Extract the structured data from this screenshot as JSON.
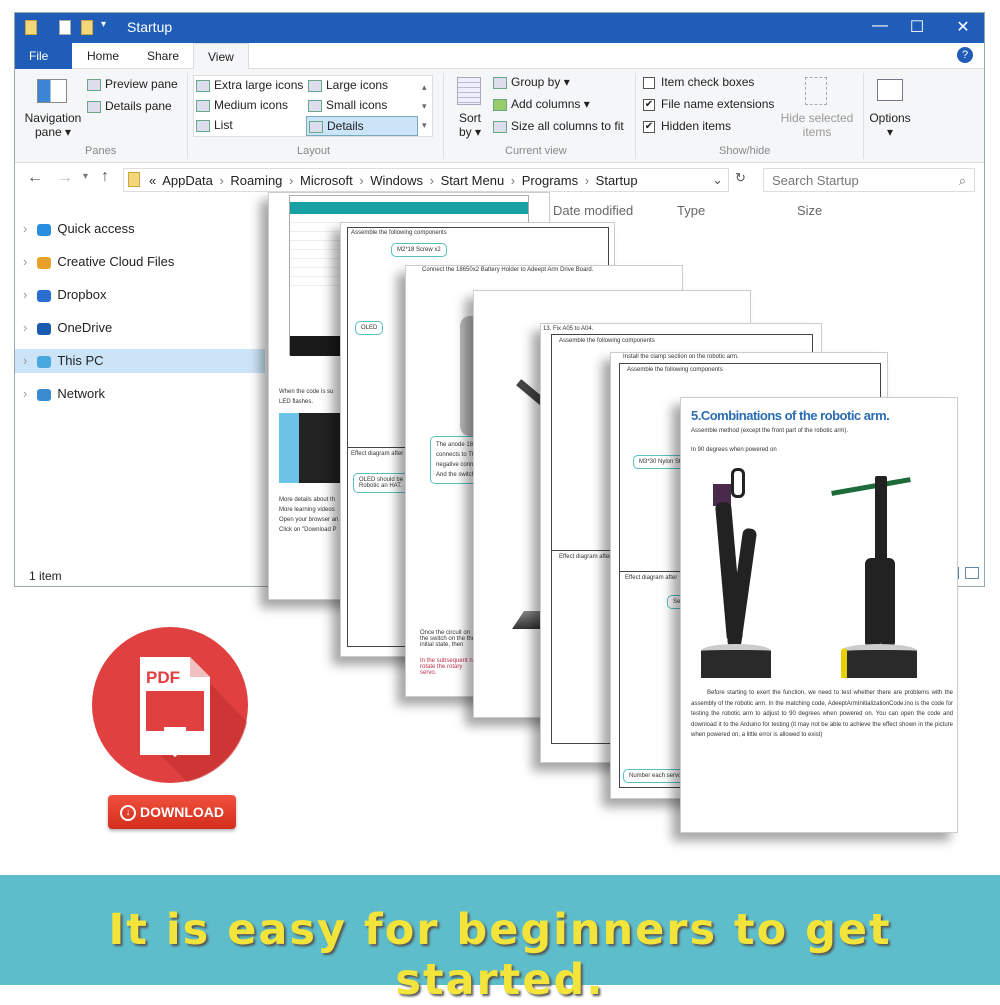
{
  "window": {
    "title": "Startup",
    "tabs": [
      "File",
      "Home",
      "Share",
      "View"
    ],
    "controls": {
      "minimize": "—",
      "maximize": "☐",
      "close": "✕",
      "help": "?"
    }
  },
  "ribbon": {
    "panes": {
      "navigation_pane": "Navigation pane ▾",
      "preview_pane": "Preview pane",
      "details_pane": "Details pane",
      "group": "Panes"
    },
    "layout": {
      "items": [
        "Extra large icons",
        "Large icons",
        "Medium icons",
        "Small icons",
        "List",
        "Details"
      ],
      "selected": "Details",
      "group": "Layout"
    },
    "current_view": {
      "sort_by": "Sort by ▾",
      "group_by": "Group by ▾",
      "add_columns": "Add columns ▾",
      "size_columns": "Size all columns to fit",
      "group": "Current view"
    },
    "show_hide": {
      "item_check_boxes": {
        "label": "Item check boxes",
        "checked": false
      },
      "file_name_extensions": {
        "label": "File name extensions",
        "checked": true
      },
      "hidden_items": {
        "label": "Hidden items",
        "checked": true
      },
      "hide_selected": "Hide selected items",
      "group": "Show/hide"
    },
    "options": "Options ▾"
  },
  "address": {
    "breadcrumb": [
      "«",
      "AppData",
      "Roaming",
      "Microsoft",
      "Windows",
      "Start Menu",
      "Programs",
      "Startup"
    ],
    "search_placeholder": "Search Startup"
  },
  "columns": [
    "Date modified",
    "Type",
    "Size"
  ],
  "nav": [
    {
      "label": "Quick access",
      "icon": "star-icon"
    },
    {
      "label": "Creative Cloud Files",
      "icon": "creative-cloud-icon"
    },
    {
      "label": "Dropbox",
      "icon": "dropbox-icon"
    },
    {
      "label": "OneDrive",
      "icon": "onedrive-icon"
    },
    {
      "label": "This PC",
      "icon": "computer-icon",
      "selected": true
    },
    {
      "label": "Network",
      "icon": "network-icon"
    }
  ],
  "status": "1 item",
  "pages": {
    "p1": {
      "lines": [
        "When the code is su",
        "LED flashes.",
        "More details about th",
        "More learning videos",
        "Open your browser an",
        "Click on \"Download P"
      ]
    },
    "p2": {
      "heading": "Assemble the following components",
      "screw": "M2*18 Screw   x2",
      "oled": "OLED",
      "effect": "Effect diagram after",
      "note": "OLED should be in the Robotic an HAT."
    },
    "p3": {
      "heading": "Connect the 18650x2 Battery Holder to Adeept Arm Drive Board.",
      "note": "The anode 18650x2 connects to The negative connects to And the switch",
      "body": "Once the circuit on the switch on the the initial state, then",
      "warn": "In the subsequent not rotate the rotary servo."
    },
    "p5": {
      "step": "13. Fix A05 to A04.",
      "heading": "Assemble the following components",
      "effect": "Effect diagram after"
    },
    "p6": {
      "step": "Install the clamp section on the robotic arm.",
      "heading": "Assemble the following components",
      "screw": "M3*30 Nylon Sta",
      "effect": "Effect diagram after",
      "servo": "Serv",
      "number": "Number each servo t"
    },
    "p7": {
      "title": "5.Combinations of the robotic arm.",
      "subtitle": "Assemble method (except the front part of the robotic arm).",
      "caption": "In 90 degrees when powered on",
      "body": "Before starting to exert the function, we need to test whether there are problems with the assembly of the robotic arm. In the matching code, AdeeptArmInitializationCode.ino is the code for testing the robotic arm to adjust to 90 degrees when powered on. You can open the code and download it to the Arduino for testing (it may not be able to achieve the effect shown in the picture when powered on, a little error is allowed to exist)"
    }
  },
  "pdf": {
    "label": "PDF",
    "download": "DOWNLOAD"
  },
  "banner": "It is easy for beginners to get started.",
  "colors": {
    "titlebar": "#1f5db8",
    "banner": "#5dbdcb",
    "banner_text": "#f2e43a",
    "pdf_red": "#e0403f",
    "title_blue": "#2a6db5"
  }
}
